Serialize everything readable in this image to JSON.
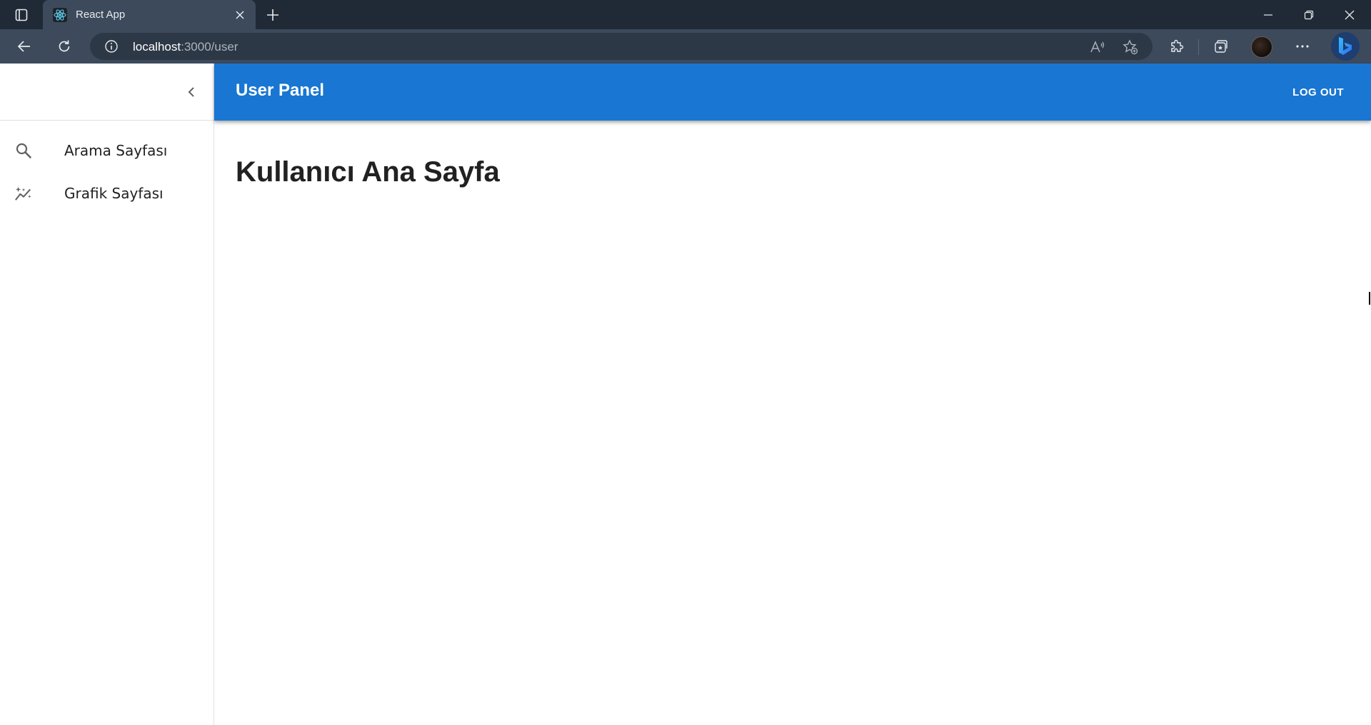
{
  "browser": {
    "tab_title": "React App",
    "url_host": "localhost",
    "url_path": ":3000/user",
    "icons": {
      "tab_actions": "tab-actions-icon",
      "favicon": "react-logo-icon",
      "tab_close": "close-icon",
      "new_tab": "plus-icon",
      "back": "back-arrow-icon",
      "reload": "reload-icon",
      "site_info": "info-icon",
      "read_aloud": "read-aloud-icon",
      "favorite": "add-favorite-icon",
      "extensions": "extensions-icon",
      "collections": "collections-icon",
      "more": "more-icon",
      "copilot": "bing-icon"
    }
  },
  "app": {
    "appbar": {
      "title": "User Panel",
      "logout_label": "LOG OUT",
      "color": "#1976d2"
    },
    "drawer": {
      "items": [
        {
          "label": "Arama Sayfası",
          "icon": "search-icon"
        },
        {
          "label": "Grafik Sayfası",
          "icon": "chart-sparkle-icon"
        }
      ]
    },
    "main": {
      "heading": "Kullanıcı Ana Sayfa"
    }
  }
}
